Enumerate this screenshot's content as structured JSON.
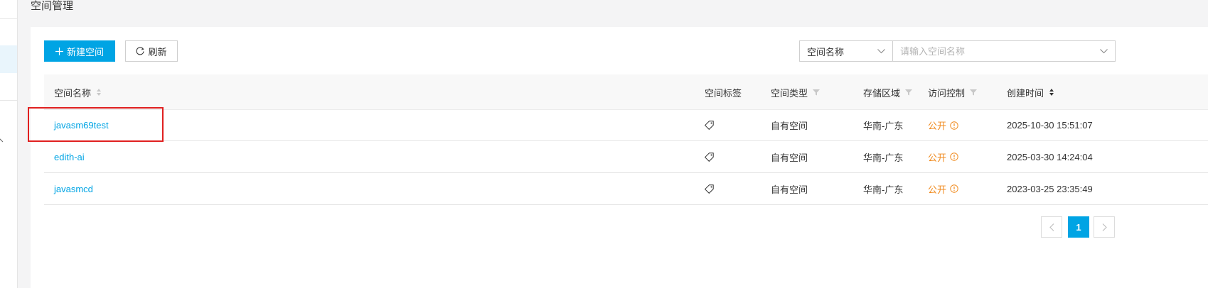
{
  "page": {
    "title": "空间管理"
  },
  "toolbar": {
    "new_label": "新建空间",
    "refresh_label": "刷新",
    "filter_field": "空间名称",
    "search_placeholder": "请输入空间名称"
  },
  "table": {
    "columns": {
      "name": "空间名称",
      "tag": "空间标签",
      "type": "空间类型",
      "region": "存储区域",
      "access": "访问控制",
      "created": "创建时间"
    },
    "rows": [
      {
        "name": "javasm69test",
        "type": "自有空间",
        "region": "华南-广东",
        "access": "公开",
        "created": "2025-10-30 15:51:07"
      },
      {
        "name": "edith-ai",
        "type": "自有空间",
        "region": "华南-广东",
        "access": "公开",
        "created": "2025-03-30 14:24:04"
      },
      {
        "name": "javasmcd",
        "type": "自有空间",
        "region": "华南-广东",
        "access": "公开",
        "created": "2023-03-25 23:35:49"
      }
    ]
  },
  "pagination": {
    "current": "1"
  },
  "colors": {
    "accent": "#00a4e4",
    "warning": "#f08a1d",
    "highlight": "#e02020"
  },
  "icons": [
    "plus-icon",
    "refresh-icon",
    "chevron-down-icon",
    "sort-icon",
    "filter-icon",
    "tag-icon",
    "info-circle-icon",
    "chevron-left-icon",
    "chevron-right-icon"
  ]
}
